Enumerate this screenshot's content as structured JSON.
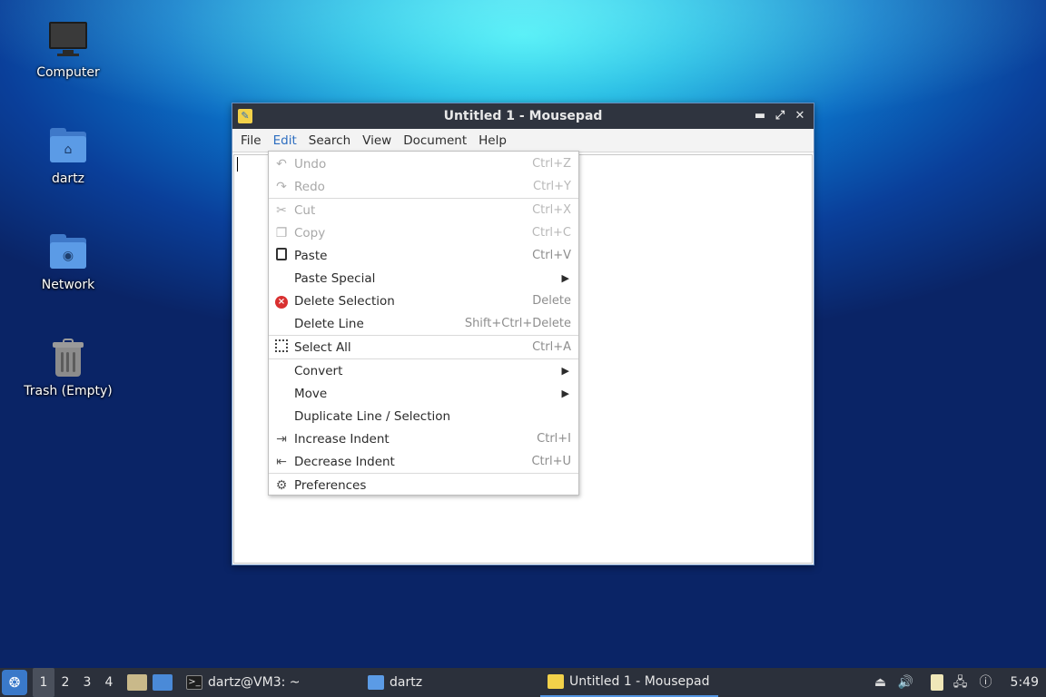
{
  "desktop": {
    "icons": [
      {
        "label": "Computer",
        "icon": "computer-icon"
      },
      {
        "label": "dartz",
        "icon": "home-folder-icon"
      },
      {
        "label": "Network",
        "icon": "network-folder-icon"
      },
      {
        "label": "Trash (Empty)",
        "icon": "trash-icon"
      }
    ]
  },
  "window": {
    "title": "Untitled 1 - Mousepad",
    "menu": [
      "File",
      "Edit",
      "Search",
      "View",
      "Document",
      "Help"
    ],
    "active_menu": "Edit"
  },
  "edit_menu": {
    "items": [
      {
        "label": "Undo",
        "accel": "Ctrl+Z",
        "icon": "undo-icon",
        "enabled": false
      },
      {
        "label": "Redo",
        "accel": "Ctrl+Y",
        "icon": "redo-icon",
        "enabled": false
      },
      {
        "label": "Cut",
        "accel": "Ctrl+X",
        "icon": "cut-icon",
        "enabled": false
      },
      {
        "label": "Copy",
        "accel": "Ctrl+C",
        "icon": "copy-icon",
        "enabled": false
      },
      {
        "label": "Paste",
        "accel": "Ctrl+V",
        "icon": "paste-icon",
        "enabled": true
      },
      {
        "label": "Paste Special",
        "accel": "",
        "submenu": true,
        "enabled": true
      },
      {
        "label": "Delete Selection",
        "accel": "Delete",
        "icon": "delete-icon",
        "enabled": true
      },
      {
        "label": "Delete Line",
        "accel": "Shift+Ctrl+Delete",
        "enabled": true
      },
      {
        "label": "Select All",
        "accel": "Ctrl+A",
        "icon": "select-all-icon",
        "enabled": true
      },
      {
        "label": "Convert",
        "accel": "",
        "submenu": true,
        "enabled": true
      },
      {
        "label": "Move",
        "accel": "",
        "submenu": true,
        "enabled": true
      },
      {
        "label": "Duplicate Line / Selection",
        "accel": "",
        "enabled": true
      },
      {
        "label": "Increase Indent",
        "accel": "Ctrl+I",
        "icon": "indent-icon",
        "enabled": true
      },
      {
        "label": "Decrease Indent",
        "accel": "Ctrl+U",
        "icon": "unindent-icon",
        "enabled": true
      },
      {
        "label": "Preferences",
        "accel": "",
        "icon": "gear-icon",
        "enabled": true
      }
    ]
  },
  "taskbar": {
    "workspaces": [
      "1",
      "2",
      "3",
      "4"
    ],
    "active_workspace": "1",
    "tasks": [
      {
        "label": "dartz@VM3: ~",
        "icon": "terminal-icon"
      },
      {
        "label": "dartz",
        "icon": "folder-icon"
      },
      {
        "label": "Untitled 1 - Mousepad",
        "icon": "mousepad-icon",
        "active": true
      }
    ],
    "clock": "5:49"
  },
  "colors": {
    "titlebar": "#2f343f",
    "taskbar": "#2b303b",
    "accent": "#2d6ec0"
  }
}
